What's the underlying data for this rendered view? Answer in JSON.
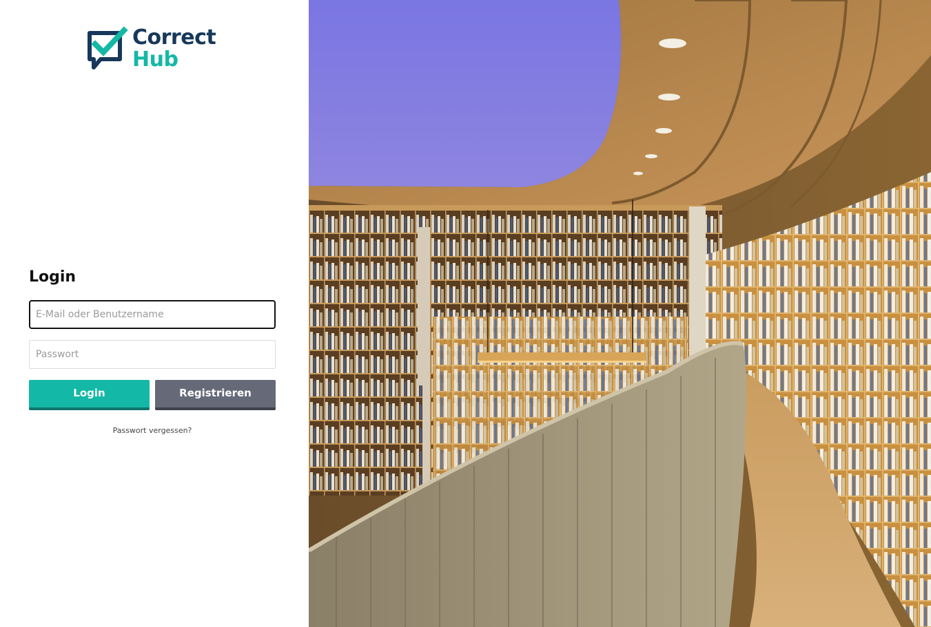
{
  "brand": {
    "word1": "Correct",
    "word2": "Hub",
    "colors": {
      "navy": "#17385a",
      "teal": "#14b8a6"
    }
  },
  "login": {
    "heading": "Login",
    "email_placeholder": "E-Mail oder Benutzername",
    "password_placeholder": "Passwort",
    "login_button": "Login",
    "register_button": "Registrieren",
    "forgot_password": "Passwort vergessen?"
  },
  "hero": {
    "icon": "library-bookshelves-photo"
  },
  "colors": {
    "login_button": "#14b8a6",
    "register_button": "#666a78"
  }
}
